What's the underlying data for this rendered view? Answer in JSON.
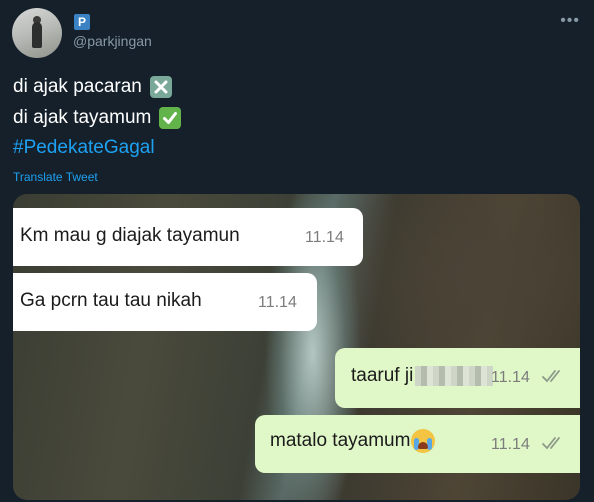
{
  "tweet": {
    "author_initial": "P",
    "handle": "@parkjingan",
    "more_label": "•••",
    "line1": "di ajak pacaran",
    "line1_emoji": "cross-mark-icon",
    "line2": "di ajak tayamum",
    "line2_emoji": "check-mark-icon",
    "hashtag": "#PedekateGagal",
    "translate_label": "Translate Tweet"
  },
  "chat": {
    "messages": [
      {
        "side": "incoming",
        "text": "Km mau g diajak tayamun",
        "time": "11.14"
      },
      {
        "side": "incoming",
        "text": "Ga pcrn tau tau nikah",
        "time": "11.14"
      },
      {
        "side": "outgoing",
        "text": "taaruf ji",
        "time": "11.14",
        "status_icon": "double-check-icon"
      },
      {
        "side": "outgoing",
        "text": "matalo tayamum",
        "time": "11.14",
        "emoji": "crying-face-icon",
        "status_icon": "double-check-icon"
      }
    ]
  },
  "colors": {
    "background": "#15202b",
    "link": "#1da1f2",
    "muted": "#8899a6",
    "incoming_bubble": "#ffffff",
    "outgoing_bubble": "#e0f7c8"
  }
}
